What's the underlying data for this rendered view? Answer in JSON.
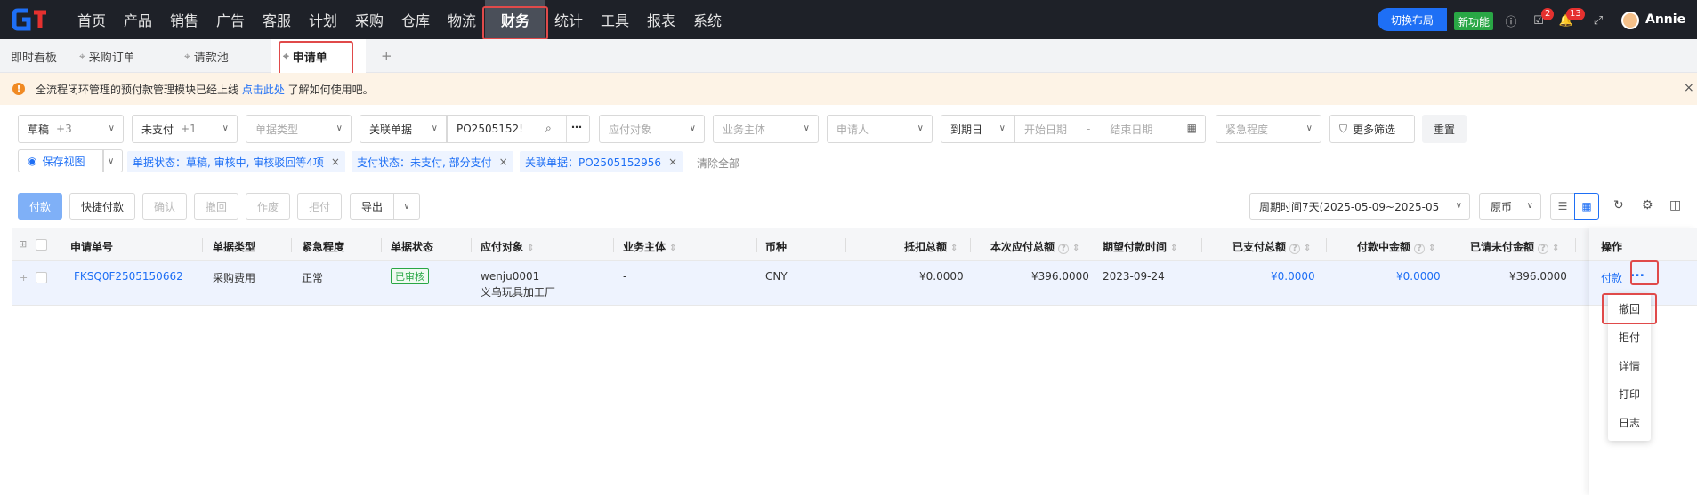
{
  "nav": {
    "items": [
      "首页",
      "产品",
      "销售",
      "广告",
      "客服",
      "计划",
      "采购",
      "仓库",
      "物流",
      "财务",
      "统计",
      "工具",
      "报表",
      "系统"
    ],
    "active": "财务",
    "switch_layout": "切换布局",
    "new_feature": "新功能",
    "badge_tasks": "2",
    "badge_bell": "13",
    "user": "Annie"
  },
  "tabs": {
    "items": [
      "即时看板",
      "采购订单",
      "请款池",
      "申请单"
    ],
    "active": "申请单",
    "add": "+"
  },
  "notice": {
    "icon": "!",
    "text_before": "全流程闭环管理的预付款管理模块已经上线 ",
    "link": "点击此处",
    "text_after": " 了解如何使用吧。",
    "close": "×"
  },
  "filters": {
    "draft": "草稿",
    "draft_count": "+3",
    "unpaid": "未支付",
    "unpaid_count": "+1",
    "doc_type": "单据类型",
    "related_doc": "关联单据",
    "related_value": "PO2505152!",
    "payee": "应付对象",
    "entity": "业务主体",
    "applicant": "申请人",
    "due_date": "到期日",
    "start_date": "开始日期",
    "date_sep": "-",
    "end_date": "结束日期",
    "urgency": "紧急程度",
    "more": "更多筛选",
    "reset": "重置"
  },
  "tags": {
    "save_view": "保存视图",
    "chip1": "单据状态：草稿, 审核中, 审核驳回等4项",
    "chip2": "支付状态：未支付, 部分支付",
    "chip3": "关联单据：PO2505152956",
    "clear": "清除全部"
  },
  "toolbar": {
    "pay": "付款",
    "quick_pay": "快捷付款",
    "confirm": "确认",
    "withdraw": "撤回",
    "void": "作废",
    "reject": "拒付",
    "export": "导出",
    "period": "周期时间7天(2025-05-09~2025-05",
    "currency": "原币"
  },
  "table": {
    "headers": [
      "申请单号",
      "单据类型",
      "紧急程度",
      "单据状态",
      "应付对象",
      "业务主体",
      "币种",
      "抵扣总额",
      "本次应付总额",
      "期望付款时间",
      "已支付总额",
      "付款中金额",
      "已请未付金额",
      "操作"
    ],
    "rows": [
      {
        "id": "FKSQ0F2505150662",
        "type": "采购费用",
        "urgency": "正常",
        "status": "已审核",
        "payee_line1": "wenju0001",
        "payee_line2": "义乌玩具加工厂",
        "entity": "-",
        "currency": "CNY",
        "deduction": "¥0.0000",
        "payable": "¥396.0000",
        "expected_date": "2023-09-24",
        "paid": "¥0.0000",
        "paying": "¥0.0000",
        "unpaid": "¥396.0000",
        "op_pay": "付款",
        "op_more": "..."
      }
    ]
  },
  "menu": {
    "items": [
      "撤回",
      "拒付",
      "详情",
      "打印",
      "日志"
    ]
  }
}
